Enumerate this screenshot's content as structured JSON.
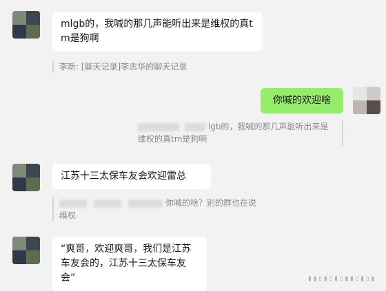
{
  "messages": [
    {
      "side": "left",
      "text": "mlgb的，我喊的那几声能听出来是维权的真tm是狗啊",
      "quote": "李新: [聊天记录]李志华的聊天记录"
    },
    {
      "side": "right",
      "text": "你喊的欢迎啥",
      "quote": "lgb的，我喊的那几声能听出来是维权的真tm是狗啊"
    },
    {
      "side": "left",
      "text": "江苏十三太保车友会欢迎雷总",
      "quote": "你喊的啥？别的群也在说维权"
    },
    {
      "side": "left",
      "text": "“爽哥，欢迎爽哥，我们是江苏车友会的，江苏十三太保车友会”"
    }
  ],
  "colors": {
    "background": "#f2f2f2",
    "bubble_left": "#ffffff",
    "bubble_right": "#95ec69",
    "quote_text": "#8a8a8a"
  }
}
